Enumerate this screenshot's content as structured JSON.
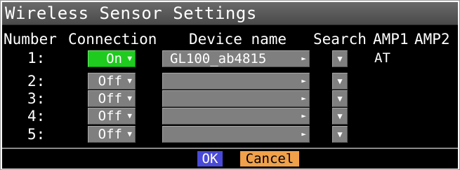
{
  "window": {
    "title": "Wireless Sensor Settings"
  },
  "headers": {
    "number": "Number",
    "connection": "Connection",
    "device_name": "Device name",
    "search": "Search",
    "amp1": "AMP1",
    "amp2": "AMP2"
  },
  "rows": [
    {
      "number": "1:",
      "connection": "On",
      "device": "GL100_ab4815",
      "amp1": "AT",
      "amp2": ""
    },
    {
      "number": "2:",
      "connection": "Off",
      "device": "",
      "amp1": "",
      "amp2": ""
    },
    {
      "number": "3:",
      "connection": "Off",
      "device": "",
      "amp1": "",
      "amp2": ""
    },
    {
      "number": "4:",
      "connection": "Off",
      "device": "",
      "amp1": "",
      "amp2": ""
    },
    {
      "number": "5:",
      "connection": "Off",
      "device": "",
      "amp1": "",
      "amp2": ""
    }
  ],
  "icons": {
    "dropdown": "▼",
    "arrow_right": "►",
    "search": "▼"
  },
  "buttons": {
    "ok": "OK",
    "cancel": "Cancel"
  },
  "colors": {
    "on_state": "#1ecb1e",
    "off_state": "#7f7f7f",
    "ok_button": "#4a4ad8",
    "cancel_button": "#f0a14a"
  }
}
